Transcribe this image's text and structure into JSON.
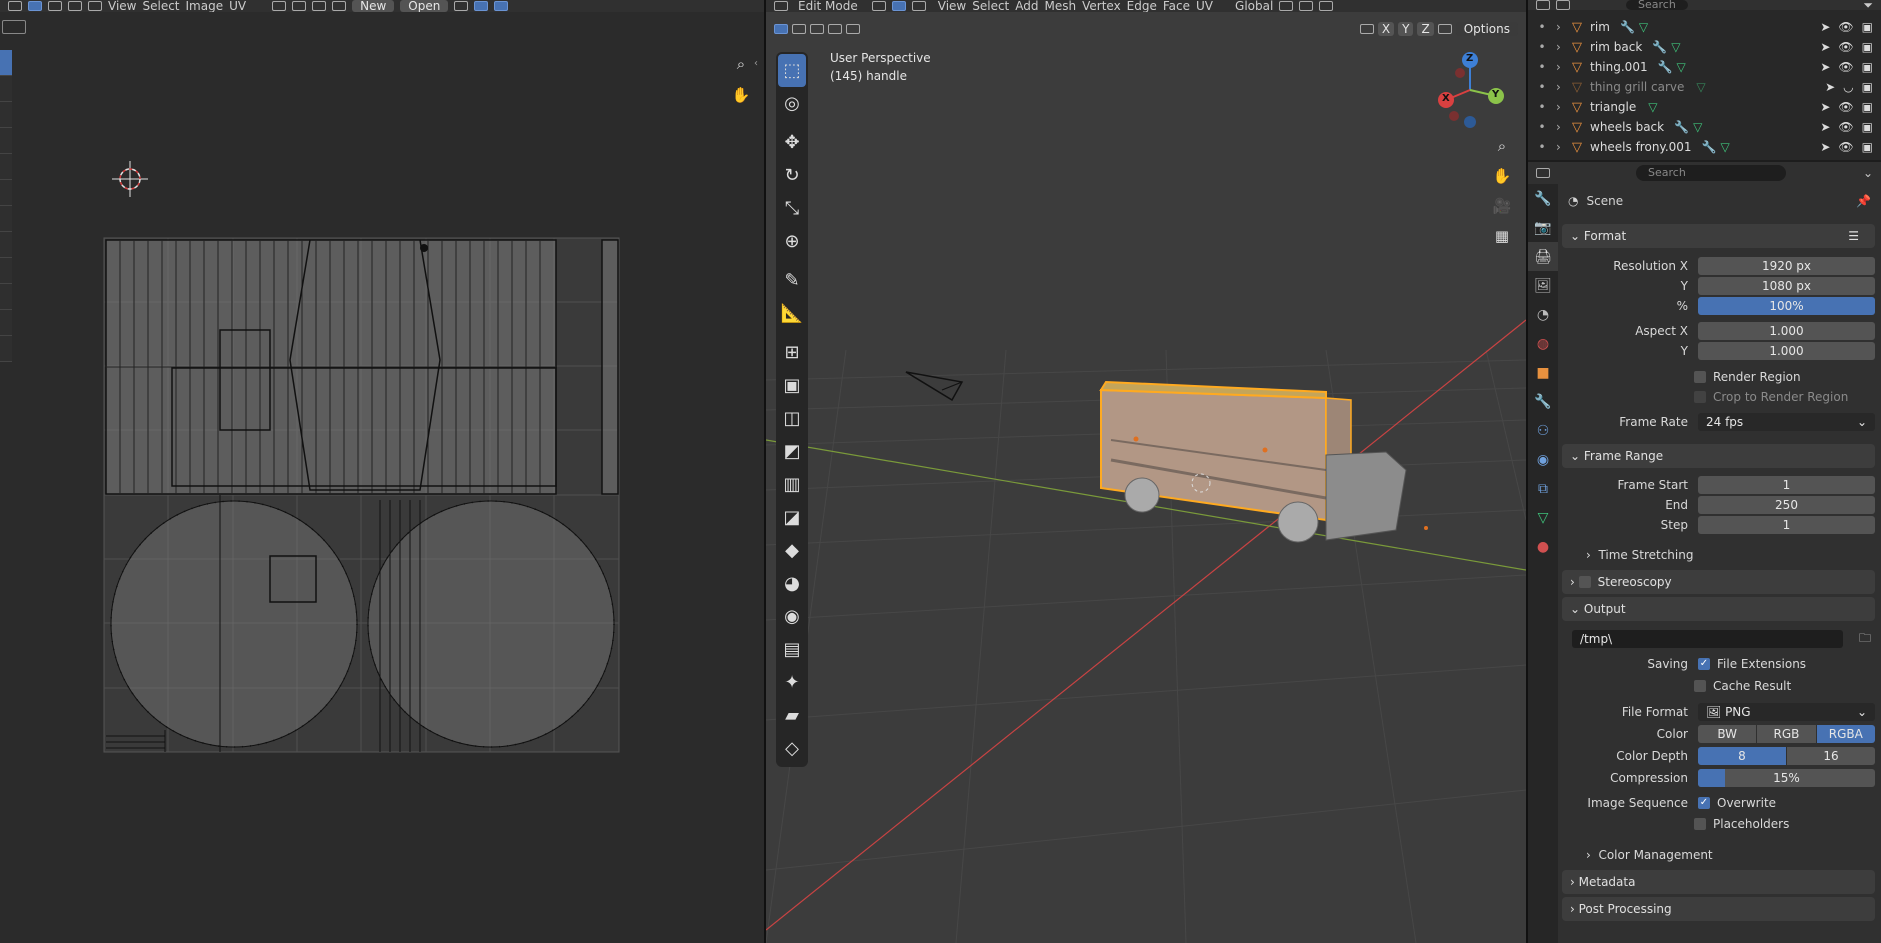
{
  "uv_editor": {
    "menu": [
      "View",
      "Select",
      "Image",
      "UV"
    ],
    "new_label": "New",
    "open_label": "Open"
  },
  "viewport": {
    "mode": "Edit Mode",
    "menu": [
      "View",
      "Select",
      "Add",
      "Mesh",
      "Vertex",
      "Edge",
      "Face",
      "UV"
    ],
    "orientation": "Global",
    "options_label": "Options",
    "axis_locks": [
      "X",
      "Y",
      "Z"
    ],
    "overlay_title": "User Perspective",
    "overlay_object": "(145) handle",
    "gizmo_axes": [
      "X",
      "Y",
      "Z"
    ]
  },
  "outliner": {
    "search_placeholder": "Search",
    "items": [
      {
        "name": "rim",
        "dim": false
      },
      {
        "name": "rim back",
        "dim": false
      },
      {
        "name": "thing.001",
        "dim": false
      },
      {
        "name": "thing grill carve",
        "dim": true
      },
      {
        "name": "triangle",
        "dim": false
      },
      {
        "name": "wheels back",
        "dim": false
      },
      {
        "name": "wheels frony.001",
        "dim": false
      }
    ]
  },
  "properties": {
    "search_placeholder": "Search",
    "context": "Scene",
    "format": {
      "title": "Format",
      "res_x_label": "Resolution X",
      "res_x": "1920 px",
      "res_y_label": "Y",
      "res_y": "1080 px",
      "pct_label": "%",
      "pct": "100%",
      "aspect_x_label": "Aspect X",
      "aspect_x": "1.000",
      "aspect_y_label": "Y",
      "aspect_y": "1.000",
      "render_region": "Render Region",
      "crop": "Crop to Render Region",
      "frame_rate_label": "Frame Rate",
      "frame_rate": "24 fps"
    },
    "frame_range": {
      "title": "Frame Range",
      "start_label": "Frame Start",
      "start": "1",
      "end_label": "End",
      "end": "250",
      "step_label": "Step",
      "step": "1",
      "time_stretching": "Time Stretching"
    },
    "stereoscopy": "Stereoscopy",
    "output": {
      "title": "Output",
      "path": "/tmp\\",
      "saving_label": "Saving",
      "file_extensions": "File Extensions",
      "cache_result": "Cache Result",
      "file_format_label": "File Format",
      "file_format": "PNG",
      "color_label": "Color",
      "color_options": [
        "BW",
        "RGB",
        "RGBA"
      ],
      "color_selected": "RGBA",
      "depth_label": "Color Depth",
      "depth_options": [
        "8",
        "16"
      ],
      "depth_selected": "8",
      "compression_label": "Compression",
      "compression": "15%",
      "compression_value": 0.15,
      "image_seq_label": "Image Sequence",
      "overwrite": "Overwrite",
      "placeholders": "Placeholders",
      "color_management": "Color Management"
    },
    "metadata": "Metadata",
    "post_processing": "Post Processing"
  },
  "colors": {
    "accent": "#4772b3",
    "selection": "#ffaa20",
    "x_axis": "#d94040",
    "y_axis": "#8bc34a",
    "z_axis": "#3d7fd6"
  }
}
